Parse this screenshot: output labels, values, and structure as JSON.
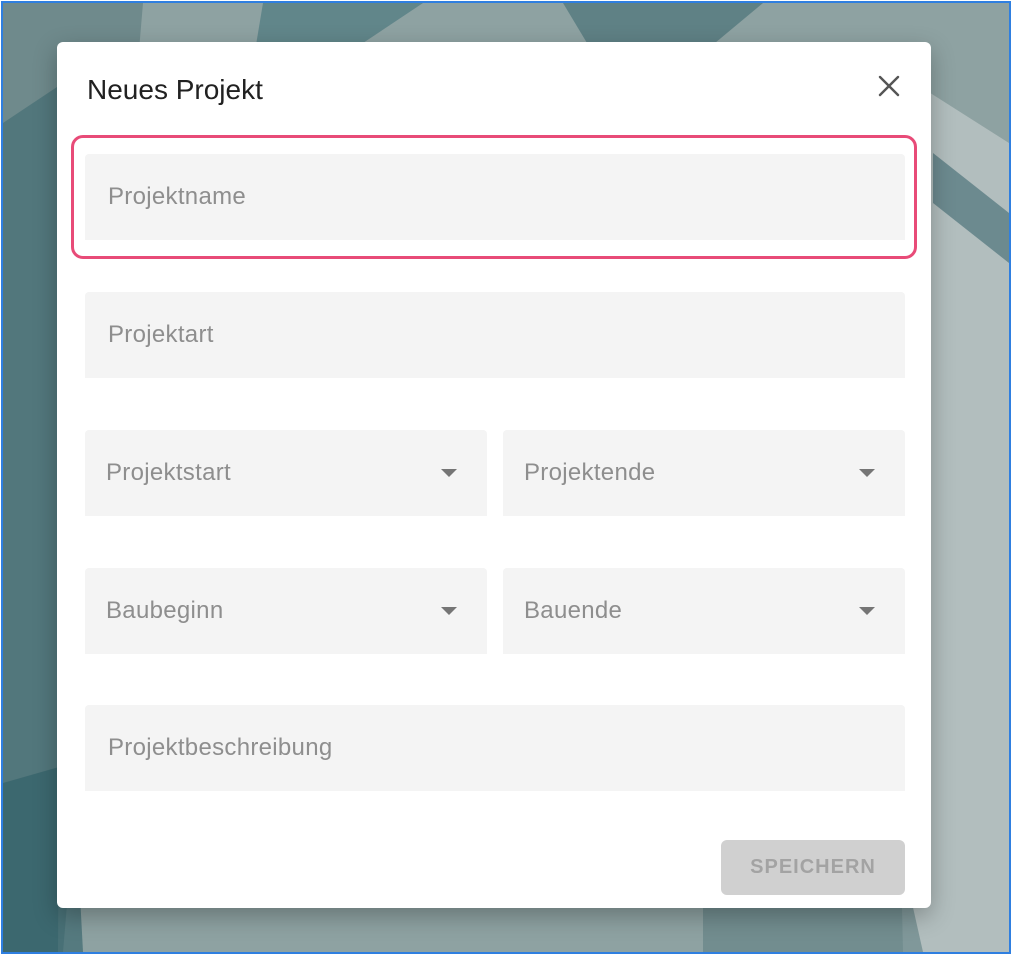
{
  "dialog": {
    "title": "Neues Projekt",
    "close_icon": "close-icon"
  },
  "fields": {
    "project_name": {
      "placeholder": "Projektname",
      "value": ""
    },
    "project_type": {
      "placeholder": "Projektart",
      "value": ""
    },
    "project_start": {
      "label": "Projektstart",
      "icon": "chevron-down-icon"
    },
    "project_end": {
      "label": "Projektende",
      "icon": "chevron-down-icon"
    },
    "construction_start": {
      "label": "Baubeginn",
      "icon": "chevron-down-icon"
    },
    "construction_end": {
      "label": "Bauende",
      "icon": "chevron-down-icon"
    },
    "project_description": {
      "placeholder": "Projektbeschreibung",
      "value": ""
    }
  },
  "actions": {
    "save_label": "SPEICHERN",
    "save_enabled": false
  },
  "colors": {
    "highlight": "#e84b78",
    "frame_border": "#2f7fe0",
    "field_background": "#f4f4f4",
    "disabled_button": "#d0d0d0"
  }
}
